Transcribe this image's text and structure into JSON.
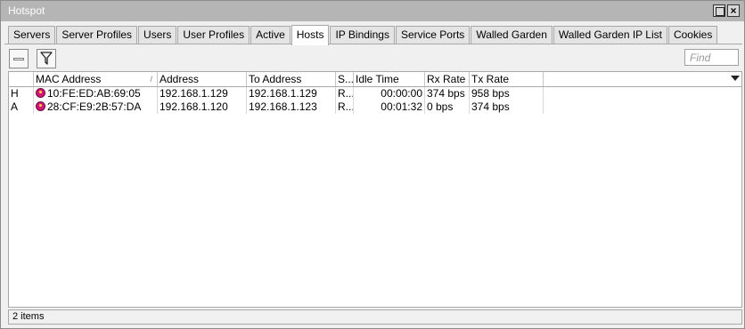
{
  "window": {
    "title": "Hotspot"
  },
  "tabs": [
    {
      "label": "Servers"
    },
    {
      "label": "Server Profiles"
    },
    {
      "label": "Users"
    },
    {
      "label": "User Profiles"
    },
    {
      "label": "Active"
    },
    {
      "label": "Hosts"
    },
    {
      "label": "IP Bindings"
    },
    {
      "label": "Service Ports"
    },
    {
      "label": "Walled Garden"
    },
    {
      "label": "Walled Garden IP List"
    },
    {
      "label": "Cookies"
    }
  ],
  "active_tab": "Hosts",
  "toolbar": {
    "remove_icon": "remove-icon",
    "filter_icon": "filter-icon",
    "find_placeholder": "Find"
  },
  "table": {
    "columns": {
      "flag": "",
      "mac": "MAC Address",
      "address": "Address",
      "to_address": "To Address",
      "s": "S...",
      "idle": "Idle Time",
      "rx": "Rx Rate",
      "tx": "Tx Rate"
    },
    "sort_indicator": "/",
    "rows": [
      {
        "flag": "H",
        "mac": "10:FE:ED:AB:69:05",
        "address": "192.168.1.129",
        "to_address": "192.168.1.129",
        "s": "R...",
        "idle": "00:00:00",
        "rx": "374 bps",
        "tx": "958 bps"
      },
      {
        "flag": "A",
        "mac": "28:CF:E9:2B:57:DA",
        "address": "192.168.1.120",
        "to_address": "192.168.1.123",
        "s": "R...",
        "idle": "00:01:32",
        "rx": "0 bps",
        "tx": "374 bps"
      }
    ]
  },
  "status": {
    "text": "2 items"
  },
  "colors": {
    "titlebar": "#b5b5b5",
    "host_icon": "#d21675"
  }
}
